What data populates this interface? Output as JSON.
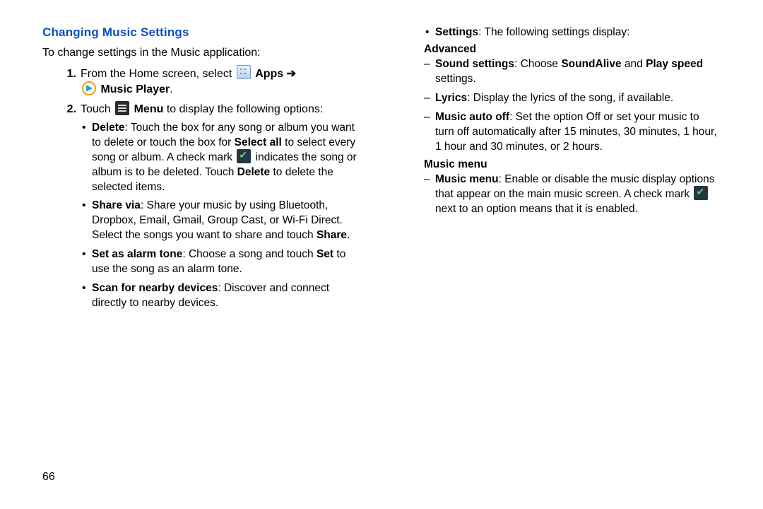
{
  "page_number": "66",
  "left": {
    "heading": "Changing Music Settings",
    "intro": "To change settings in the Music application:",
    "step1_num": "1.",
    "step1_a": "From the Home screen, select ",
    "step1_apps": "Apps",
    "step1_arrow": " ➔",
    "step1_music": "Music Player",
    "step1_period": ".",
    "step2_num": "2.",
    "step2_a": "Touch ",
    "step2_menu": "Menu",
    "step2_b": " to display the following options:",
    "bullets": {
      "delete_label": "Delete",
      "delete_a": ": Touch the box for any song or album you want to delete or touch the box for ",
      "delete_selectall": "Select all",
      "delete_b": " to select every song or album. A check mark ",
      "delete_c": " indicates the song or album is to be deleted. Touch ",
      "delete_touch": "Delete",
      "delete_d": " to delete the selected items.",
      "share_label": "Share via",
      "share_a": ": Share your music by using Bluetooth, Dropbox, Email, Gmail, Group Cast, or Wi-Fi Direct. Select the songs you want to share and touch ",
      "share_touch": "Share",
      "share_b": ".",
      "alarm_label": "Set as alarm tone",
      "alarm_a": ": Choose a song and touch ",
      "alarm_set": "Set",
      "alarm_b": " to use the song as an alarm tone.",
      "scan_label": "Scan for nearby devices",
      "scan_a": ": Discover and connect directly to nearby devices."
    }
  },
  "right": {
    "settings_label": "Settings",
    "settings_text": ": The following settings display:",
    "advanced_head": "Advanced",
    "sound_label": "Sound settings",
    "sound_a": ": Choose ",
    "sound_alive": "SoundAlive",
    "sound_and": " and ",
    "sound_speed": "Play speed",
    "sound_b": " settings.",
    "lyrics_label": "Lyrics",
    "lyrics_text": ": Display the lyrics of the song, if available.",
    "auto_label": "Music auto off",
    "auto_text": ": Set the option Off or set your music to turn off automatically after 15 minutes, 30 minutes, 1 hour, 1 hour and 30 minutes, or 2 hours.",
    "menu_head": "Music menu",
    "menu_label": "Music menu",
    "menu_a": ": Enable or disable the music display options that appear on the main music screen. A check mark ",
    "menu_b": " next to an option means that it is enabled."
  }
}
